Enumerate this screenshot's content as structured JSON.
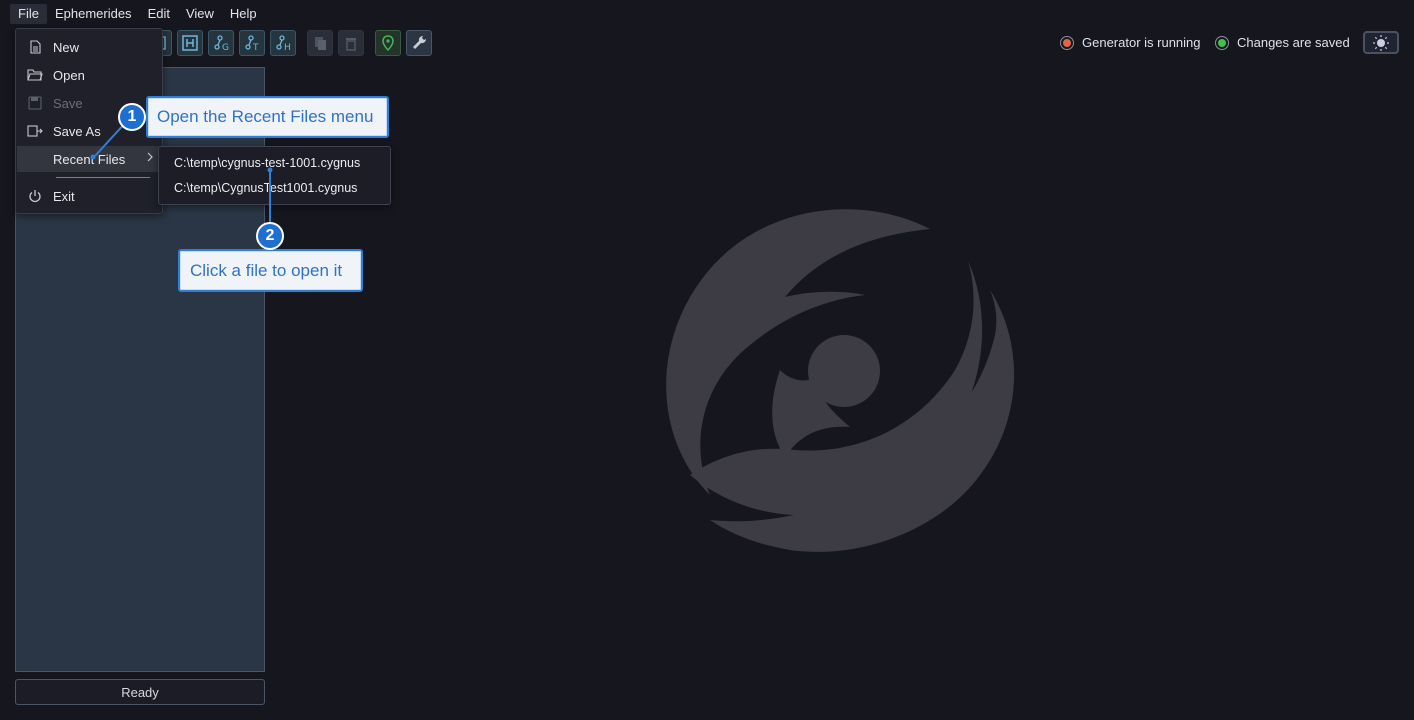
{
  "menubar": {
    "items": [
      {
        "label": "File"
      },
      {
        "label": "Ephemerides"
      },
      {
        "label": "Edit"
      },
      {
        "label": "View"
      },
      {
        "label": "Help"
      }
    ]
  },
  "file_menu": {
    "new": "New",
    "open": "Open",
    "save": "Save",
    "save_as": "Save As",
    "recent_files": "Recent Files",
    "exit": "Exit"
  },
  "recent_files": [
    "C:\\temp\\cygnus-test-1001.cygnus",
    "C:\\temp\\CygnusTest1001.cygnus"
  ],
  "status": {
    "generator": "Generator is running",
    "generator_color": "#e8643c",
    "saved": "Changes are saved",
    "saved_color": "#3cc44a"
  },
  "statusbar": {
    "text": "Ready"
  },
  "callouts": [
    {
      "number": "1",
      "text": "Open the Recent Files menu"
    },
    {
      "number": "2",
      "text": "Click a file to open it"
    }
  ],
  "toolbar_icons": [
    "frame-icon",
    "hex-h-icon",
    "node-g-icon",
    "node-t-icon",
    "node-h-icon",
    "copy-icon",
    "trash-icon",
    "location-pin-icon",
    "wrench-icon"
  ],
  "colors": {
    "background": "#16161f",
    "panel": "#2a3646",
    "accent": "#2f7fd9",
    "logo": "#3d3c44"
  }
}
